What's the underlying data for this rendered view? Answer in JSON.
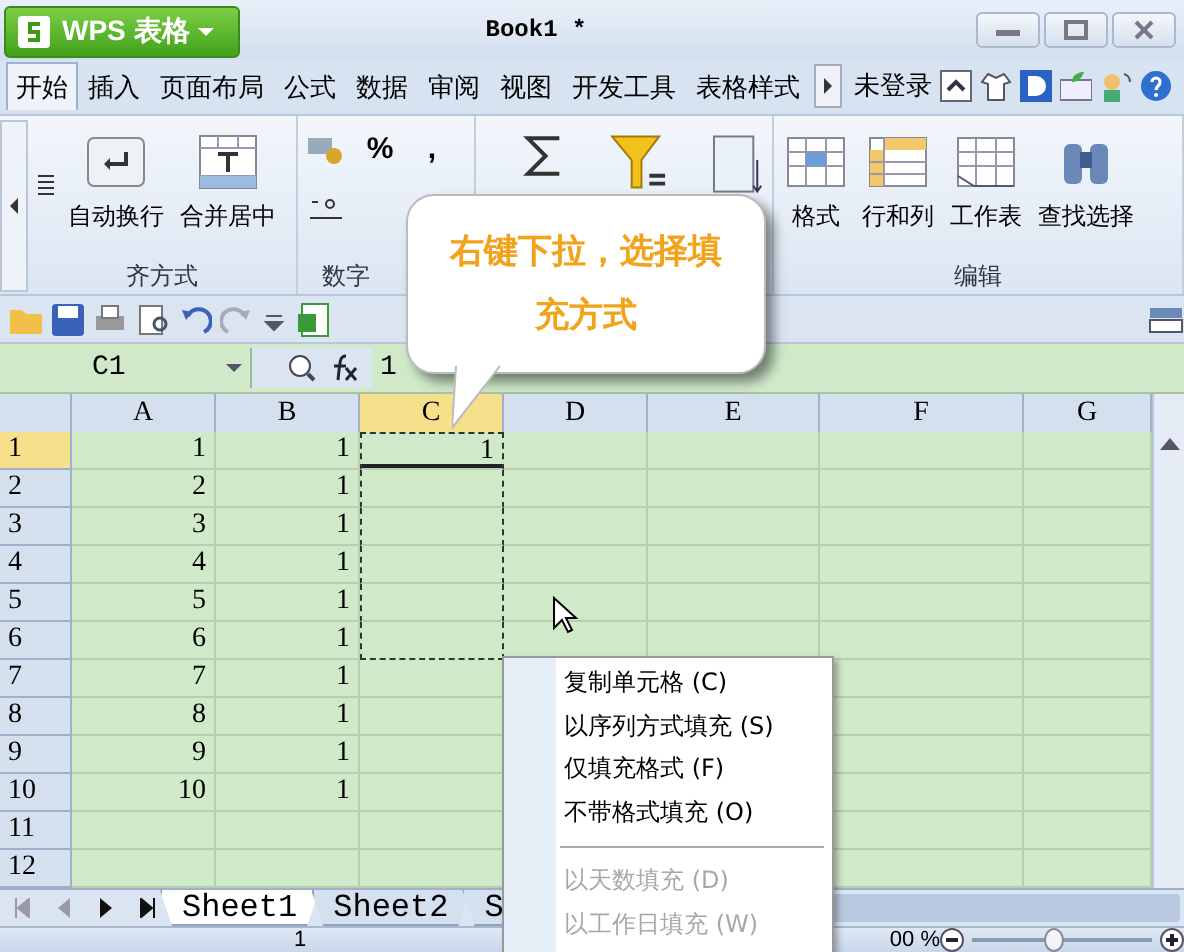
{
  "title_bar": {
    "app_button": "WPS 表格",
    "document_title": "Book1 *"
  },
  "menu_tabs": [
    {
      "label": "开始",
      "selected": true
    },
    {
      "label": "插入",
      "selected": false
    },
    {
      "label": "页面布局",
      "selected": false
    },
    {
      "label": "公式",
      "selected": false
    },
    {
      "label": "数据",
      "selected": false
    },
    {
      "label": "审阅",
      "selected": false
    },
    {
      "label": "视图",
      "selected": false
    },
    {
      "label": "开发工具",
      "selected": false
    },
    {
      "label": "表格样式",
      "selected": false
    }
  ],
  "account": "未登录",
  "ribbon": {
    "groups": [
      {
        "label": "齐方式",
        "kind": "align",
        "buttons": [
          "自动换行",
          "合并居中"
        ]
      },
      {
        "label": "数字",
        "kind": "number",
        "symbols": [
          "%",
          ","
        ]
      },
      {
        "kind": "tools"
      },
      {
        "label": "编辑",
        "kind": "edit",
        "buttons": [
          "格式",
          "行和列",
          "工作表",
          "查找选择"
        ]
      }
    ]
  },
  "formula_bar": {
    "name_box": "C1",
    "formula": "1"
  },
  "callout": {
    "text": "右键下拉，选择填充方式"
  },
  "sheet": {
    "columns": [
      {
        "label": "A",
        "selected": false
      },
      {
        "label": "B",
        "selected": false
      },
      {
        "label": "C",
        "selected": true
      },
      {
        "label": "D",
        "selected": false
      },
      {
        "label": "E",
        "selected": false
      },
      {
        "label": "F",
        "selected": false
      },
      {
        "label": "G",
        "selected": false
      }
    ],
    "rows": [
      {
        "header": "1",
        "active": true,
        "in_fill_range": true,
        "cells": [
          "1",
          "1",
          "1"
        ]
      },
      {
        "header": "2",
        "active": false,
        "in_fill_range": true,
        "cells": [
          "2",
          "1"
        ]
      },
      {
        "header": "3",
        "active": false,
        "in_fill_range": true,
        "cells": [
          "3",
          "1"
        ]
      },
      {
        "header": "4",
        "active": false,
        "in_fill_range": true,
        "cells": [
          "4",
          "1"
        ]
      },
      {
        "header": "5",
        "active": false,
        "in_fill_range": true,
        "cells": [
          "5",
          "1"
        ]
      },
      {
        "header": "6",
        "active": false,
        "in_fill_range": true,
        "cells": [
          "6",
          "1"
        ]
      },
      {
        "header": "7",
        "active": false,
        "in_fill_range": false,
        "cells": [
          "7",
          "1"
        ]
      },
      {
        "header": "8",
        "active": false,
        "in_fill_range": false,
        "cells": [
          "8",
          "1"
        ]
      },
      {
        "header": "9",
        "active": false,
        "in_fill_range": false,
        "cells": [
          "9",
          "1"
        ]
      },
      {
        "header": "10",
        "active": false,
        "in_fill_range": false,
        "cells": [
          "10",
          "1"
        ]
      },
      {
        "header": "11",
        "active": false,
        "in_fill_range": false,
        "cells": []
      },
      {
        "header": "12",
        "active": false,
        "in_fill_range": false,
        "cells": []
      }
    ]
  },
  "sheet_tabs": [
    {
      "label": "Sheet1",
      "selected": true
    },
    {
      "label": "Sheet2",
      "selected": false
    },
    {
      "label": "S",
      "selected": false
    }
  ],
  "status_bar": {
    "sum": "1",
    "zoom": "00 %",
    "zoom_level": {
      "level": 0.45
    }
  },
  "context_menu": {
    "items": [
      {
        "kind": "item",
        "label": "复制单元格",
        "shortcut": "(C)",
        "disabled": false
      },
      {
        "kind": "item",
        "label": "以序列方式填充",
        "shortcut": "(S)",
        "disabled": false
      },
      {
        "kind": "item",
        "label": "仅填充格式",
        "shortcut": "(F)",
        "disabled": false
      },
      {
        "kind": "item",
        "label": "不带格式填充",
        "shortcut": "(O)",
        "disabled": false
      },
      {
        "kind": "separator"
      },
      {
        "kind": "item",
        "label": "以天数填充",
        "shortcut": "(D)",
        "disabled": true
      },
      {
        "kind": "item",
        "label": "以工作日填充",
        "shortcut": "(W)",
        "disabled": true
      }
    ]
  }
}
